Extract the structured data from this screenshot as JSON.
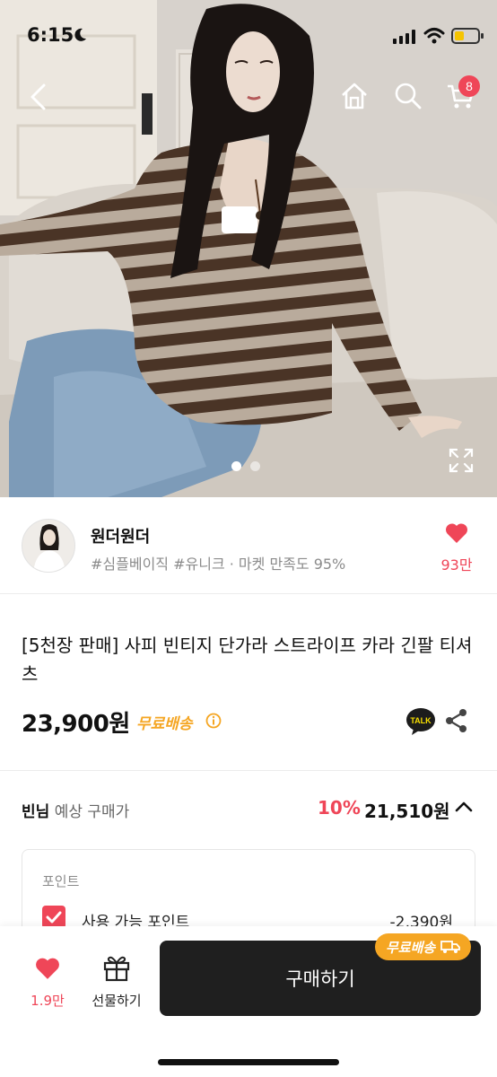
{
  "status_bar": {
    "time": "6:15"
  },
  "header": {
    "cart_count": "8"
  },
  "icons": [
    "back-icon",
    "home-icon",
    "search-icon",
    "cart-icon",
    "expand-icon",
    "heart-icon",
    "kakao-talk-icon",
    "share-icon",
    "chevron-up-icon",
    "gift-icon",
    "truck-icon",
    "info-icon"
  ],
  "gallery": {
    "total": 2,
    "active": 1
  },
  "shop": {
    "name": "원더원더",
    "tags": "#심플베이직 #유니크 · 마켓 만족도 95%",
    "likes": "93만"
  },
  "product": {
    "title": "[5천장 판매] 사피 빈티지 단가라 스트라이프 카라 긴팔 티셔츠",
    "price": "23,900원",
    "free_shipping": "무료배송",
    "talk_label": "TALK"
  },
  "member": {
    "grade": "빈님",
    "label": "예상 구매가",
    "discount": "10%",
    "price": "21,510원"
  },
  "points": {
    "title": "포인트",
    "usable_label": "사용 가능 포인트",
    "usable_value": "-2,390원"
  },
  "bottom_bar": {
    "wish_count": "1.9만",
    "gift_label": "선물하기",
    "buy_label": "구매하기",
    "ship_badge": "무료배송"
  },
  "colors": {
    "accent": "#ef4658",
    "shipping": "#f5a623",
    "buy_button": "#1f1f1f"
  }
}
